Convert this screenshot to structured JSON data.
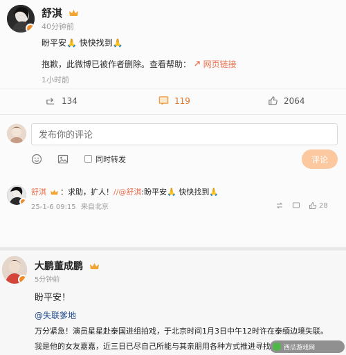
{
  "post1": {
    "author": "舒淇",
    "time": "40分钟前",
    "line1": "盼平安🙏 快快找到🙏",
    "notice": "抱歉，此微博已被作者删除。查看帮助：",
    "help_link": "网页链接",
    "repost_time": "1小时前",
    "share_count": "134",
    "comment_count": "119",
    "like_count": "2064"
  },
  "comment_box": {
    "placeholder": "发布你的评论",
    "repost_label": "同时转发",
    "submit_label": "评论"
  },
  "reply": {
    "author": "舒淇",
    "text_prefix": "：求助，扩人！",
    "mention": "//@舒淇",
    "text_suffix": ":盼平安🙏 快快找到🙏",
    "date": "25-1-6 09:15",
    "source": "来自北京",
    "likes": "28"
  },
  "post2": {
    "author": "大鹏董成鹏",
    "time": "5分钟前",
    "line1": "盼平安！",
    "hashtag": "@失联爹地",
    "line2": "万分紧急！演员星星赴泰国进组拍戏，于北京时间1月3日中午12时许在泰缅边境失联。",
    "line3": "我是他的女友嘉嘉，近三日已尽自己所能与其亲朋用各种方式推进寻找"
  },
  "watermark": "西瓜游戏网"
}
